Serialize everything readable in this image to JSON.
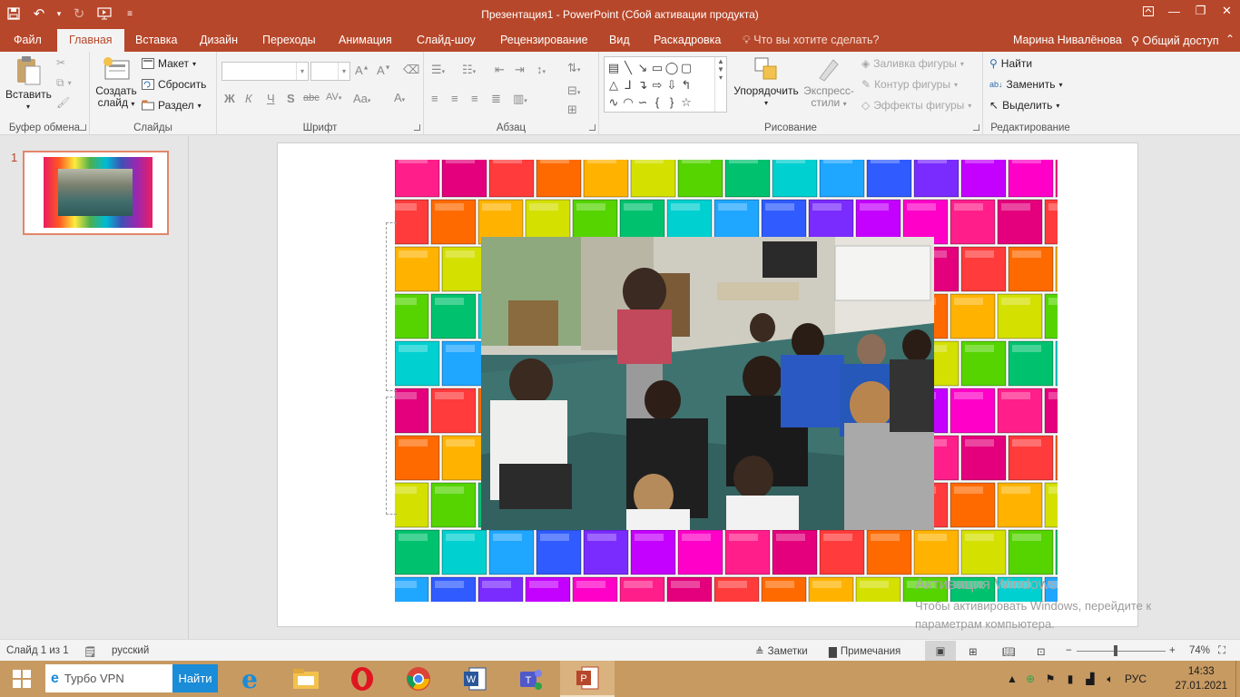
{
  "titlebar": {
    "title": "Презентация1 - PowerPoint (Сбой активации продукта)"
  },
  "tabs": [
    "Файл",
    "Главная",
    "Вставка",
    "Дизайн",
    "Переходы",
    "Анимация",
    "Слайд-шоу",
    "Рецензирование",
    "Вид",
    "Раскадровка"
  ],
  "tellme": "Что вы хотите сделать?",
  "user": "Марина Нивалёнова",
  "share": "Общий доступ",
  "ribbon": {
    "clipboard": {
      "label": "Буфер обмена",
      "paste": "Вставить"
    },
    "slides": {
      "label": "Слайды",
      "new_slide_1": "Создать",
      "new_slide_2": "слайд",
      "layout": "Макет",
      "reset": "Сбросить",
      "section": "Раздел"
    },
    "font": {
      "label": "Шрифт",
      "bold": "Ж",
      "italic": "К",
      "underline": "Ч",
      "shadow": "S",
      "strike": "abc",
      "spacing": "AV",
      "case": "Aa"
    },
    "paragraph": {
      "label": "Абзац"
    },
    "drawing": {
      "label": "Рисование",
      "arrange": "Упорядочить",
      "styles_1": "Экспресс-",
      "styles_2": "стили",
      "fill": "Заливка фигуры",
      "outline": "Контур фигуры",
      "effects": "Эффекты фигуры"
    },
    "editing": {
      "label": "Редактирование",
      "find": "Найти",
      "replace": "Заменить",
      "select": "Выделить"
    }
  },
  "thumbnail": {
    "number": "1"
  },
  "watermark": {
    "line1": "Активация Windows",
    "line2": "Чтобы активировать Windows, перейдите к",
    "line3": "параметрам компьютера."
  },
  "status": {
    "slide": "Слайд 1 из 1",
    "language": "русский",
    "notes": "Заметки",
    "comments": "Примечания",
    "zoom": "74%",
    "zoom_value": 0.74
  },
  "taskbar": {
    "search_text": "Турбо VPN",
    "search_button": "Найти",
    "lang": "РУС",
    "time": "14:33",
    "date": "27.01.2021"
  }
}
